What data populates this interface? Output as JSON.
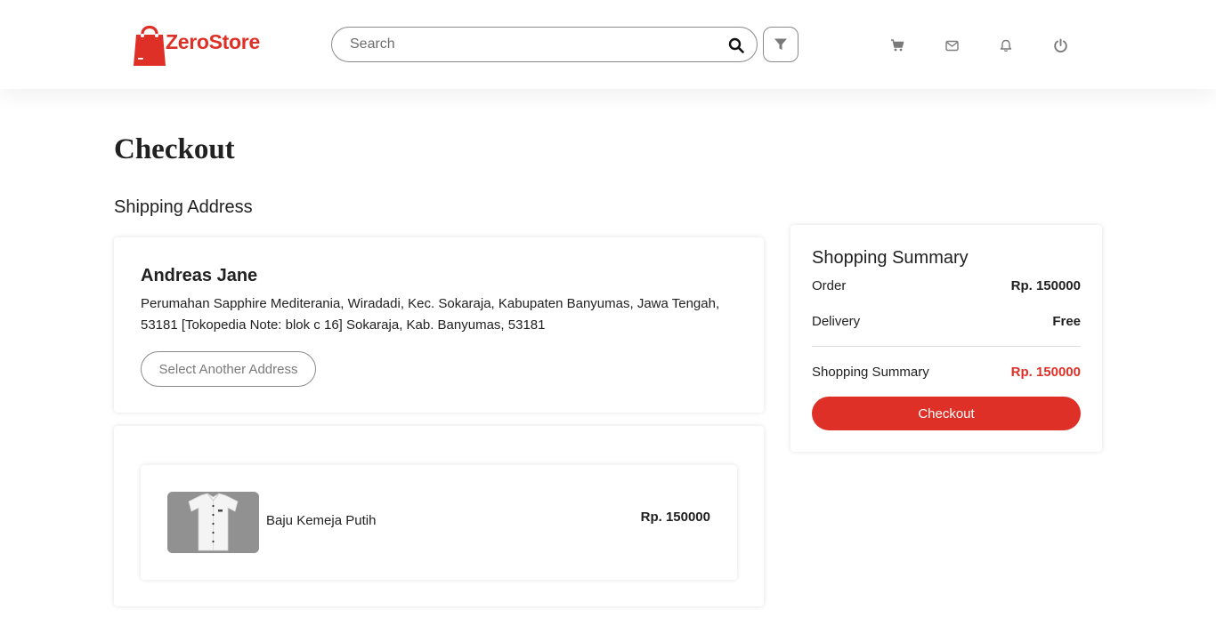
{
  "brand": {
    "name": "ZeroStore",
    "color": "#de3027"
  },
  "header": {
    "search_placeholder": "Search",
    "icons": [
      "search-icon",
      "filter-icon",
      "cart-icon",
      "mail-icon",
      "bell-icon",
      "power-icon"
    ]
  },
  "page": {
    "title": "Checkout",
    "shipping_title": "Shipping Address"
  },
  "address": {
    "name": "Andreas Jane",
    "text": "Perumahan Sapphire Mediterania, Wiradadi, Kec. Sokaraja, Kabupaten Banyumas, Jawa Tengah, 53181 [Tokopedia Note: blok c 16] Sokaraja, Kab. Banyumas, 53181",
    "select_button": "Select Another Address"
  },
  "products": [
    {
      "name": "Baju Kemeja Putih",
      "price": "Rp. 150000"
    }
  ],
  "summary": {
    "title": "Shopping Summary",
    "order_label": "Order",
    "order_value": "Rp. 150000",
    "delivery_label": "Delivery",
    "delivery_value": "Free",
    "total_label": "Shopping Summary",
    "total_value": "Rp. 150000",
    "checkout_button": "Checkout"
  }
}
